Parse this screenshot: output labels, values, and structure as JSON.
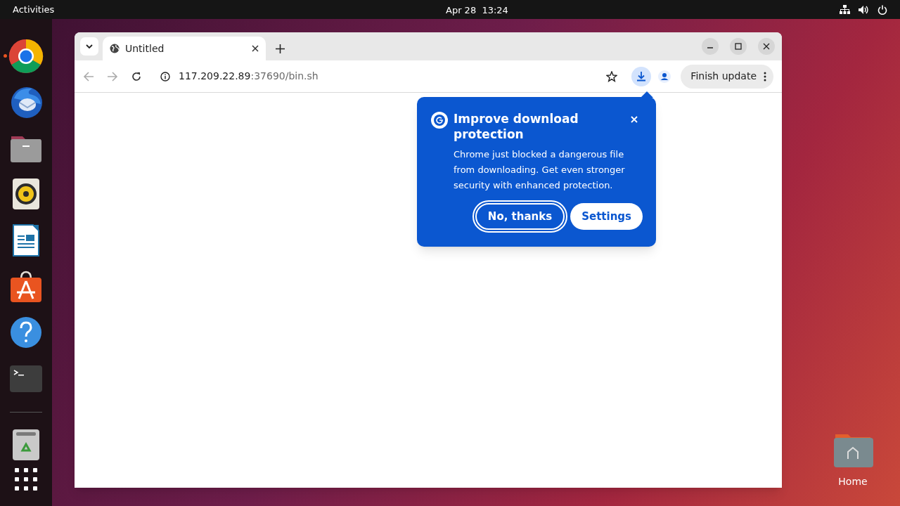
{
  "top_bar": {
    "activities": "Activities",
    "clock": "Apr 28  13:24"
  },
  "dock": {
    "apps": [
      {
        "kind": "chrome",
        "running": true
      },
      {
        "kind": "mail",
        "running": false
      },
      {
        "kind": "files",
        "running": false
      },
      {
        "kind": "audio",
        "running": false
      },
      {
        "kind": "writer",
        "running": false
      },
      {
        "kind": "store",
        "running": false
      },
      {
        "kind": "help",
        "running": false
      },
      {
        "kind": "terminal",
        "running": false
      },
      {
        "kind": "trash",
        "running": false
      }
    ]
  },
  "browser": {
    "tabs": [
      {
        "title": "Untitled",
        "selected": true
      }
    ],
    "address": {
      "host": "117.209.22.89",
      "path": ":37690/bin.sh"
    },
    "update_button": "Finish update",
    "popup": {
      "title": "Improve download protection",
      "body": "Chrome just blocked a dangerous file from downloading. Get even stronger security with enhanced protection.",
      "buttons": [
        {
          "label": "No, thanks",
          "kind": "outline"
        },
        {
          "label": "Settings",
          "kind": "filled"
        }
      ]
    }
  },
  "desktop": {
    "icons": [
      {
        "label": "Home"
      }
    ]
  }
}
